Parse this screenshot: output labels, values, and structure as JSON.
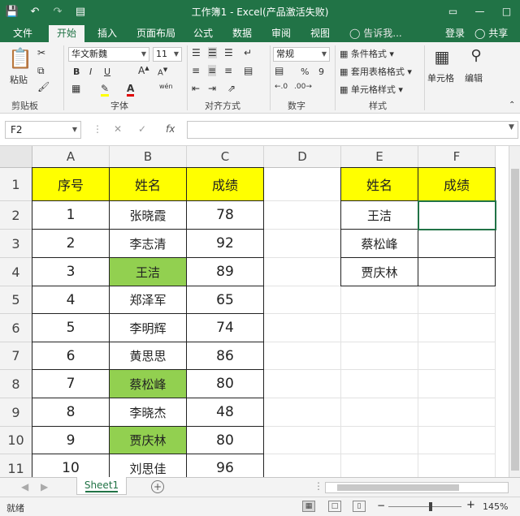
{
  "window": {
    "title": "工作簿1 - Excel(产品激活失败)"
  },
  "qat": {
    "save_icon": "save-icon",
    "undo_icon": "undo-icon",
    "redo_icon": "redo-icon",
    "customize_icon": "customize-icon"
  },
  "tabs": [
    "文件",
    "开始",
    "插入",
    "页面布局",
    "公式",
    "数据",
    "审阅",
    "视图"
  ],
  "active_tab": "开始",
  "tell_me": "告诉我...",
  "login": "登录",
  "share": "共享",
  "ribbon": {
    "paste": "粘贴",
    "clipboard_group": "剪贴板",
    "font_name": "华文新魏",
    "font_size": "11",
    "bold": "B",
    "italic": "I",
    "underline": "U",
    "font_group": "字体",
    "align_group": "对齐方式",
    "number_format": "常规",
    "percent": "%",
    "comma": "9",
    "number_group": "数字",
    "cond_format": "条件格式",
    "table_format": "套用表格格式",
    "cell_style": "单元格样式",
    "style_group": "样式",
    "cells": "单元格",
    "editing": "编辑",
    "wen": "wén"
  },
  "formula_bar": {
    "name_box": "F2",
    "fx": "fx",
    "content": ""
  },
  "columns": [
    "A",
    "B",
    "C",
    "D",
    "E",
    "F"
  ],
  "rows": [
    "1",
    "2",
    "3",
    "4",
    "5",
    "6",
    "7",
    "8",
    "9",
    "10",
    "11"
  ],
  "table1": {
    "header": [
      "序号",
      "姓名",
      "成绩"
    ],
    "rows": [
      [
        "1",
        "张晓霞",
        "78"
      ],
      [
        "2",
        "李志清",
        "92"
      ],
      [
        "3",
        "王洁",
        "89"
      ],
      [
        "4",
        "郑泽军",
        "65"
      ],
      [
        "5",
        "李明辉",
        "74"
      ],
      [
        "6",
        "黄思思",
        "86"
      ],
      [
        "7",
        "蔡松峰",
        "80"
      ],
      [
        "8",
        "李晓杰",
        "48"
      ],
      [
        "9",
        "贾庆林",
        "80"
      ],
      [
        "10",
        "刘思佳",
        "96"
      ]
    ],
    "highlighted_names": [
      "王洁",
      "蔡松峰",
      "贾庆林"
    ],
    "highlight_color": "#92d050",
    "header_color": "#ffff00"
  },
  "table2": {
    "header": [
      "姓名",
      "成绩"
    ],
    "rows": [
      [
        "王洁",
        ""
      ],
      [
        "蔡松峰",
        ""
      ],
      [
        "贾庆林",
        ""
      ]
    ]
  },
  "sheet_tabs": [
    "Sheet1"
  ],
  "status": {
    "text": "就绪",
    "zoom": "145%"
  },
  "colors": {
    "accent": "#217346"
  }
}
